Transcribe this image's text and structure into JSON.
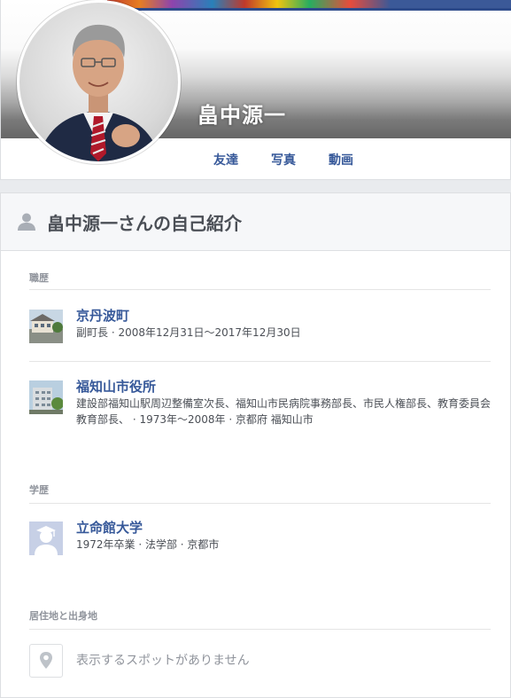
{
  "profile": {
    "name": "畠中源一",
    "nav": [
      "友達",
      "写真",
      "動画"
    ]
  },
  "about": {
    "title": "畠中源一さんの自己紹介",
    "work": {
      "label": "職歴",
      "items": [
        {
          "title": "京丹波町",
          "subtitle": "副町長 · 2008年12月31日～2017年12月30日"
        },
        {
          "title": "福知山市役所",
          "subtitle": "建設部福知山駅周辺整備室次長、福知山市民病院事務部長、市民人権部長、教育委員会教育部長、 · 1973年～2008年 · 京都府 福知山市"
        }
      ]
    },
    "education": {
      "label": "学歴",
      "items": [
        {
          "title": "立命館大学",
          "subtitle": "1972年卒業 · 法学部 · 京都市"
        }
      ]
    },
    "places": {
      "label": "居住地と出身地",
      "empty_text": "表示するスポットがありません"
    }
  },
  "colors": {
    "link": "#365899",
    "muted": "#90949c",
    "background": "#e9ebee"
  }
}
